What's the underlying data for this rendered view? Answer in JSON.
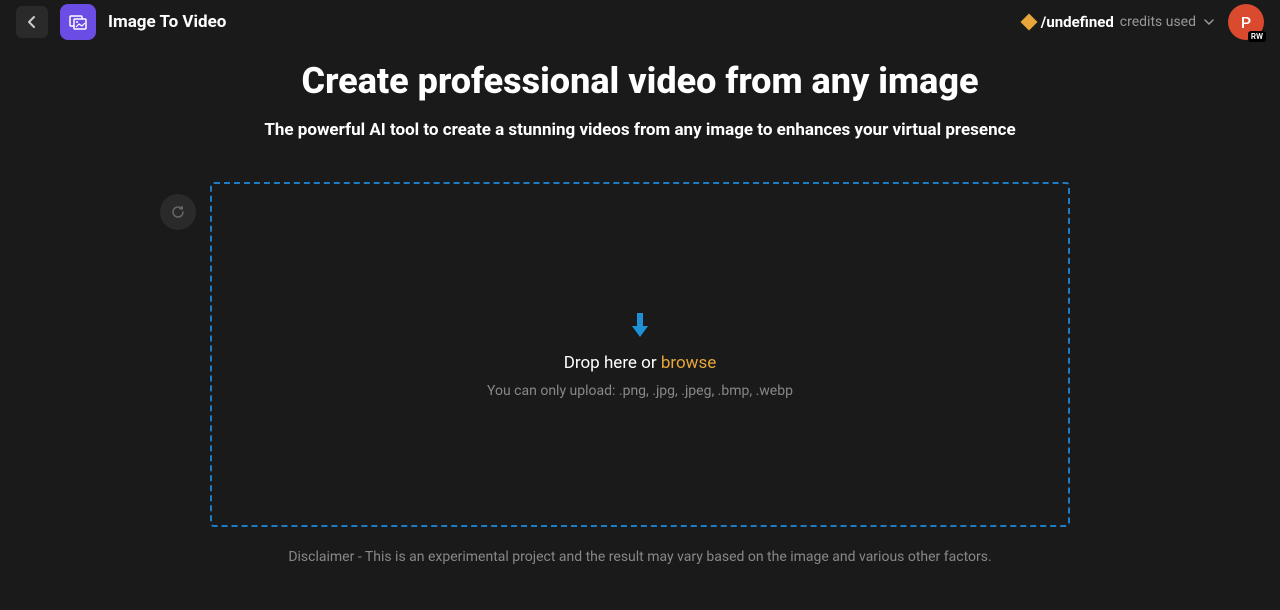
{
  "header": {
    "app_title": "Image To Video",
    "credits": {
      "value": "/undefined",
      "label": "credits used"
    },
    "avatar": {
      "initial": "P",
      "badge": "RW"
    }
  },
  "main": {
    "title": "Create professional video from any image",
    "subtitle": "The powerful AI tool to create a stunning videos from any image to enhances your virtual presence",
    "dropzone": {
      "drop_text": "Drop here or ",
      "browse_text": "browse",
      "format_text": "You can only upload: .png, .jpg, .jpeg, .bmp, .webp"
    },
    "disclaimer": "Disclaimer - This is an experimental project and the result may vary based on the image and various other factors."
  }
}
